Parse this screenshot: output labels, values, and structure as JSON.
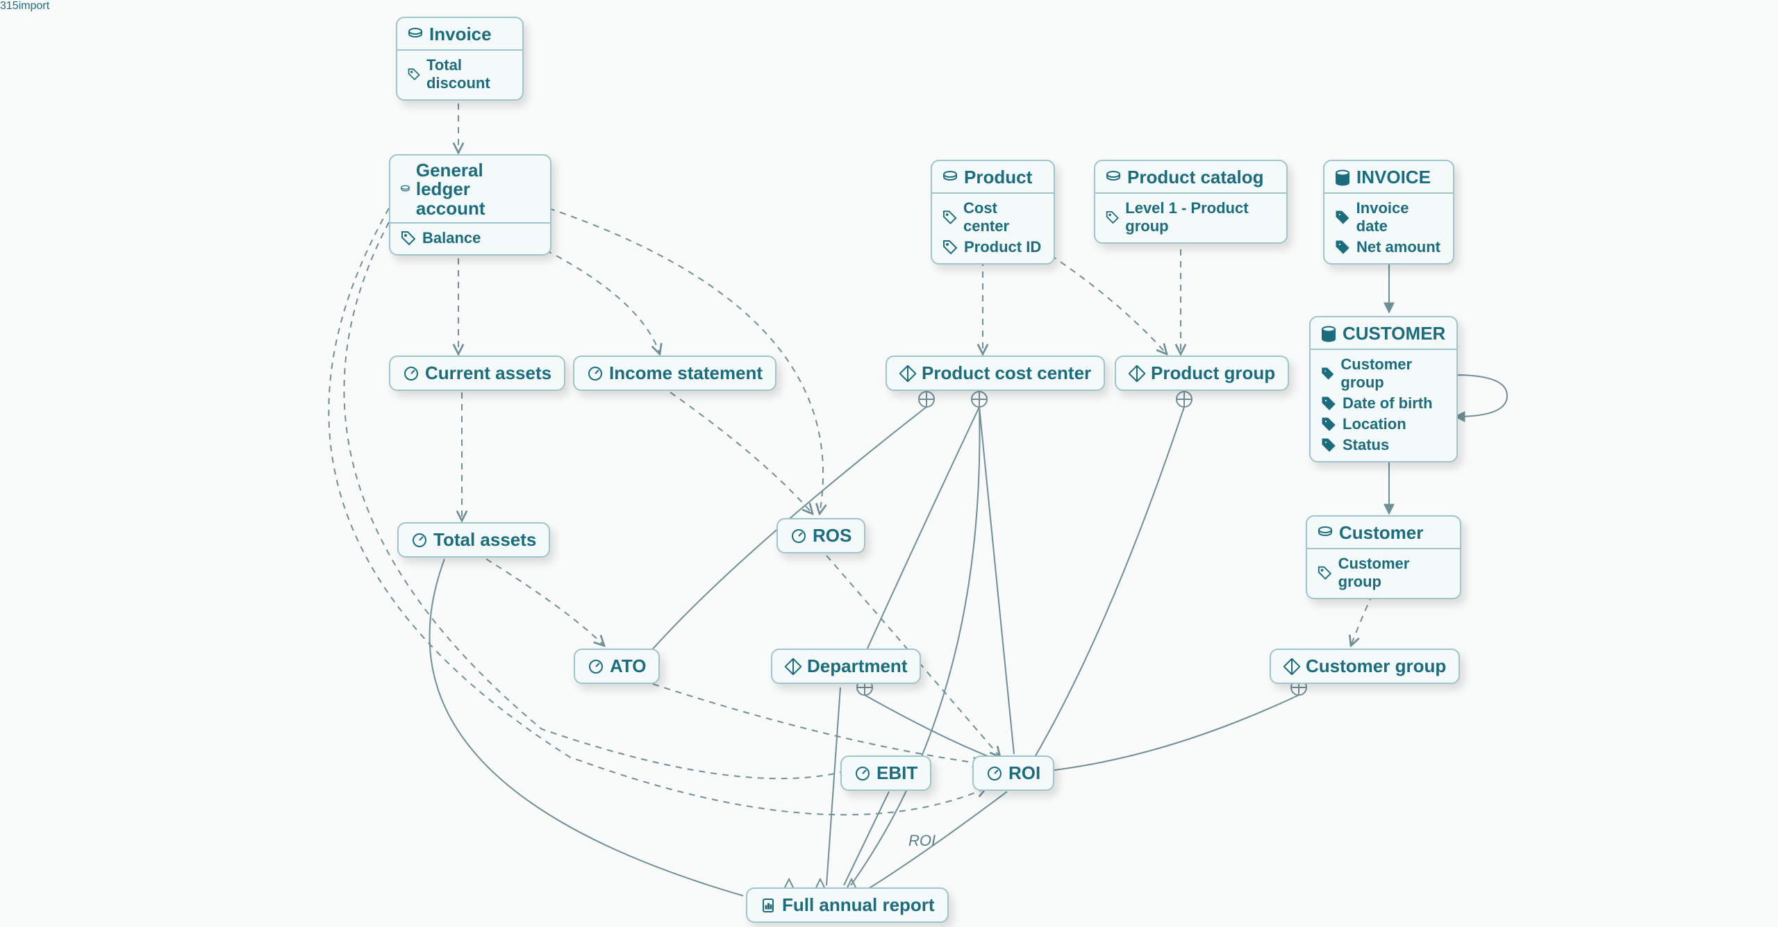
{
  "colors": {
    "line": "#6f8f96",
    "node_border": "#9fc4cb",
    "text": "#1b6d7e"
  },
  "nodes": {
    "invoice": {
      "title": "Invoice",
      "attrs": [
        "Total discount"
      ]
    },
    "gl": {
      "title": "General ledger account",
      "attrs": [
        "Balance"
      ]
    },
    "product": {
      "title": "Product",
      "attrs": [
        "Cost center",
        "Product ID"
      ]
    },
    "catalog": {
      "title": "Product catalog",
      "attrs": [
        "Level 1 - Product group"
      ]
    },
    "invoice_db": {
      "title": "INVOICE",
      "attrs": [
        "Invoice date",
        "Net amount"
      ]
    },
    "customer_db": {
      "title": "CUSTOMER",
      "attrs": [
        "Customer group",
        "Date of birth",
        "Location",
        "Status"
      ]
    },
    "customer": {
      "title": "Customer",
      "attrs": [
        "Customer group"
      ]
    },
    "current_assets": {
      "title": "Current assets"
    },
    "income_stmt": {
      "title": "Income statement"
    },
    "prod_cc": {
      "title": "Product cost center"
    },
    "prod_group": {
      "title": "Product group"
    },
    "total_assets": {
      "title": "Total assets"
    },
    "ros": {
      "title": "ROS"
    },
    "ato": {
      "title": "ATO"
    },
    "department": {
      "title": "Department"
    },
    "cust_group": {
      "title": "Customer group"
    },
    "ebit": {
      "title": "EBIT"
    },
    "roi": {
      "title": "ROI"
    },
    "report": {
      "title": "Full annual report"
    }
  },
  "edge_labels": {
    "roi": "ROI"
  },
  "edges_desc": [
    {
      "from": "invoice",
      "to": "gl",
      "style": "dashed",
      "arrow": true
    },
    {
      "from": "gl",
      "to": "current_assets",
      "style": "dashed",
      "arrow": true
    },
    {
      "from": "gl",
      "to": "income_stmt",
      "style": "dashed",
      "arrow": true
    },
    {
      "from": "gl",
      "to": "ros",
      "style": "dashed",
      "arrow": true
    },
    {
      "from": "gl",
      "to": "ebit",
      "style": "dashed",
      "arrow": true
    },
    {
      "from": "gl",
      "to": "roi",
      "style": "dashed",
      "arrow": true
    },
    {
      "from": "current_assets",
      "to": "total_assets",
      "style": "dashed",
      "arrow": true
    },
    {
      "from": "income_stmt",
      "to": "ros",
      "style": "dashed",
      "arrow": true
    },
    {
      "from": "total_assets",
      "to": "ato",
      "style": "dashed",
      "arrow": true
    },
    {
      "from": "total_assets",
      "to": "report",
      "style": "solid",
      "arrow": false,
      "curve": true
    },
    {
      "from": "ato",
      "to": "roi",
      "style": "dashed",
      "arrow": true
    },
    {
      "from": "ros",
      "to": "roi",
      "style": "dashed",
      "arrow": true
    },
    {
      "from": "product",
      "to": "prod_cc",
      "style": "dashed",
      "arrow": true
    },
    {
      "from": "product",
      "to": "prod_group",
      "style": "dashed",
      "arrow": true
    },
    {
      "from": "catalog",
      "to": "prod_group",
      "style": "dashed",
      "arrow": true
    },
    {
      "from": "prod_cc",
      "to": "ato",
      "style": "solid",
      "port": true
    },
    {
      "from": "prod_cc",
      "to": "department",
      "style": "solid",
      "port": true
    },
    {
      "from": "prod_cc",
      "to": "roi",
      "style": "solid",
      "port": true
    },
    {
      "from": "prod_cc",
      "to": "report",
      "style": "solid",
      "port": true
    },
    {
      "from": "prod_group",
      "to": "roi",
      "style": "solid",
      "port": true
    },
    {
      "from": "invoice_db",
      "to": "customer_db",
      "style": "solid",
      "arrow": true
    },
    {
      "from": "customer_db",
      "to": "customer_db",
      "style": "solid",
      "arrow": true,
      "self": true
    },
    {
      "from": "customer_db",
      "to": "customer",
      "style": "solid",
      "arrow": true
    },
    {
      "from": "customer",
      "to": "cust_group",
      "style": "dashed",
      "arrow": true
    },
    {
      "from": "cust_group",
      "to": "roi",
      "style": "solid",
      "port": true
    },
    {
      "from": "department",
      "to": "roi",
      "style": "solid",
      "port": true
    },
    {
      "from": "department",
      "to": "report",
      "style": "solid"
    },
    {
      "from": "ebit",
      "to": "report",
      "style": "solid"
    },
    {
      "from": "roi",
      "to": "report",
      "style": "solid",
      "label": "ROI"
    }
  ]
}
